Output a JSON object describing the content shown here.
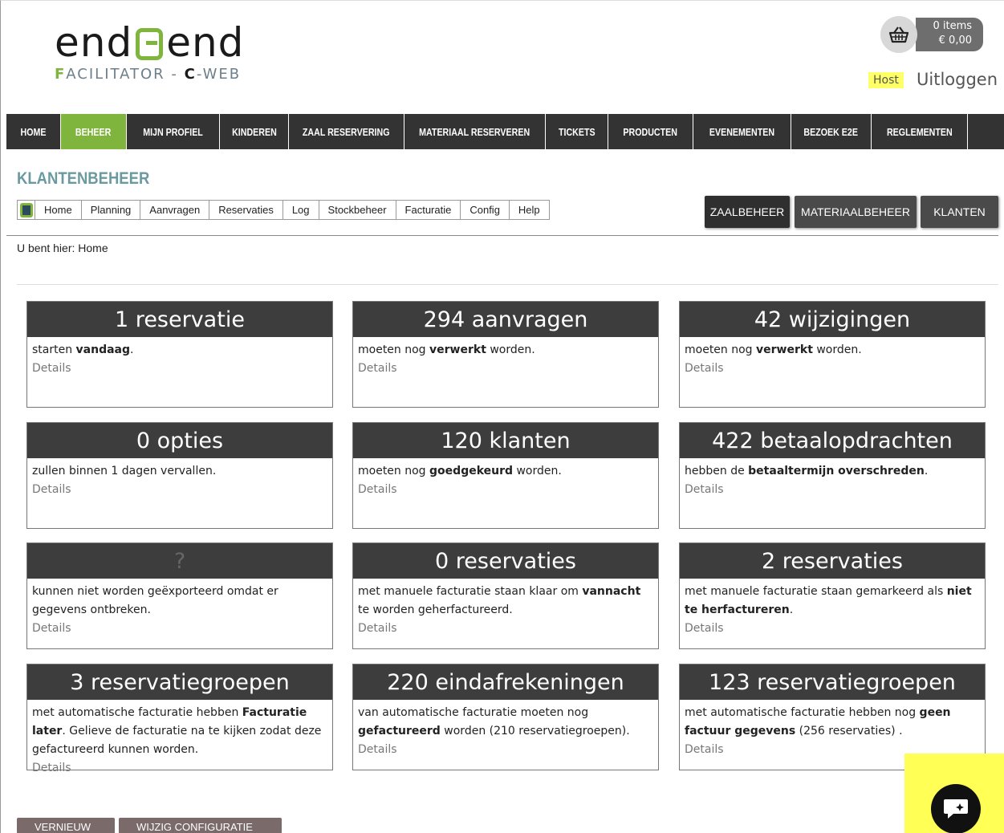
{
  "header": {
    "logo": {
      "word_left": "end",
      "word_right": "end",
      "sub_f": "F",
      "sub_rest": "ACILITATOR - ",
      "sub_c": "C",
      "sub_web": "-WEB"
    },
    "cart": {
      "items": "0 items",
      "total": "€ 0,00",
      "icon": "basket-icon"
    },
    "host_label": "Host",
    "logout_label": "Uitloggen"
  },
  "nav": {
    "items": [
      {
        "label": "HOME",
        "active": false
      },
      {
        "label": "BEHEER",
        "active": true
      },
      {
        "label": "MIJN PROFIEL",
        "active": false
      },
      {
        "label": "KINDEREN",
        "active": false
      },
      {
        "label": "ZAAL RESERVERING",
        "active": false
      },
      {
        "label": "MATERIAAL RESERVEREN",
        "active": false
      },
      {
        "label": "TICKETS",
        "active": false
      },
      {
        "label": "PRODUCTEN",
        "active": false
      },
      {
        "label": "EVENEMENTEN",
        "active": false
      },
      {
        "label": "BEZOEK E2E",
        "active": false
      },
      {
        "label": "REGLEMENTEN",
        "active": false
      }
    ],
    "active_color": "#7fb43d"
  },
  "section_title": "KLANTENBEHEER",
  "subnav": {
    "items": [
      "Home",
      "Planning",
      "Aanvragen",
      "Reservaties",
      "Log",
      "Stockbeheer",
      "Facturatie",
      "Config",
      "Help"
    ]
  },
  "right_buttons": {
    "zaal": "ZAALBEHEER",
    "materiaal": "MATERIAALBEHEER",
    "klanten": "KLANTEN"
  },
  "breadcrumb": "U bent hier: Home",
  "cards": [
    {
      "title": "1 reservatie",
      "t1": "starten ",
      "b1": "vandaag",
      "t2": ".",
      "b2": "",
      "t3": "",
      "details": "Details"
    },
    {
      "title": "294 aanvragen",
      "t1": "moeten nog ",
      "b1": "verwerkt",
      "t2": " worden.",
      "b2": "",
      "t3": "",
      "details": "Details"
    },
    {
      "title": "42 wijzigingen",
      "t1": "moeten nog ",
      "b1": "verwerkt",
      "t2": " worden.",
      "b2": "",
      "t3": "",
      "details": "Details"
    },
    {
      "title": "0 opties",
      "t1": "zullen binnen 1 dagen vervallen.",
      "b1": "",
      "t2": "",
      "b2": "",
      "t3": "",
      "details": "Details"
    },
    {
      "title": "120 klanten",
      "t1": "moeten nog ",
      "b1": "goedgekeurd",
      "t2": " worden.",
      "b2": "",
      "t3": "",
      "details": "Details"
    },
    {
      "title": "422 betaalopdrachten",
      "t1": "hebben de ",
      "b1": "betaaltermijn overschreden",
      "t2": ".",
      "b2": "",
      "t3": "",
      "details": "Details"
    },
    {
      "title": "?",
      "t1": "kunnen niet worden geëxporteerd omdat er gegevens ontbreken.",
      "b1": "",
      "t2": "",
      "b2": "",
      "t3": "",
      "details": "Details"
    },
    {
      "title": "0 reservaties",
      "t1": "met manuele facturatie staan klaar om ",
      "b1": "vannacht",
      "t2": " te worden geherfactureerd.",
      "b2": "",
      "t3": "",
      "details": "Details"
    },
    {
      "title": "2 reservaties",
      "t1": "met manuele facturatie staan gemarkeerd als ",
      "b1": "niet te herfactureren",
      "t2": ".",
      "b2": "",
      "t3": "",
      "details": "Details"
    },
    {
      "title": "3 reservatiegroepen",
      "t1": "met automatische facturatie hebben ",
      "b1": "Facturatie later",
      "t2": ". Gelieve de facturatie na te kijken zodat deze gefactureerd kunnen worden.",
      "b2": "",
      "t3": "",
      "details": "Details"
    },
    {
      "title": "220 eindafrekeningen",
      "t1": "van automatische facturatie moeten nog ",
      "b1": "gefactureerd",
      "t2": " worden (210 reservatiegroepen).",
      "b2": "",
      "t3": "",
      "details": "Details"
    },
    {
      "title": "123 reservatiegroepen",
      "t1": "met automatische facturatie hebben nog ",
      "b1": "geen factuur gegevens",
      "t2": " (256 reservaties) .",
      "b2": "",
      "t3": "",
      "details": "Details"
    }
  ],
  "bottom_buttons": {
    "refresh": "VERNIEUW",
    "config": "WIJZIG CONFIGURATIE"
  },
  "chat": {
    "icon": "chat-sparkle-icon",
    "highlight_color": "#ffff55"
  }
}
